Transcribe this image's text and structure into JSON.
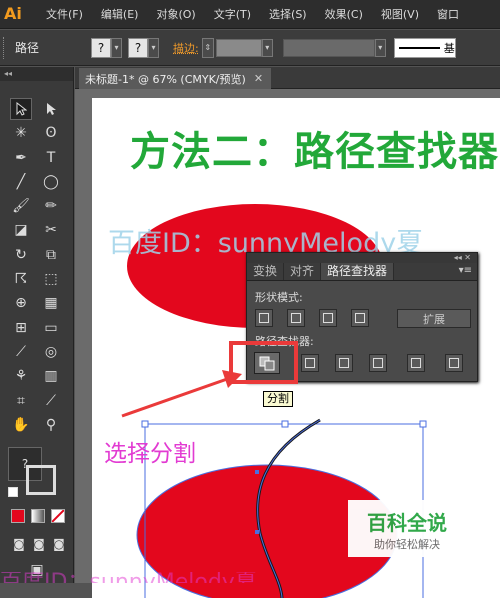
{
  "app": {
    "logo": "Ai"
  },
  "menubar": {
    "items": [
      "文件(F)",
      "编辑(E)",
      "对象(O)",
      "文字(T)",
      "选择(S)",
      "效果(C)",
      "视图(V)",
      "窗口"
    ]
  },
  "control_bar": {
    "label": "路径",
    "stroke_label": "描边:",
    "fill_box": "?",
    "stroke_box": "?",
    "basic_label": "基"
  },
  "document_tab": {
    "title": "未标题-1* @ 67% (CMYK/预览)",
    "close": "✕"
  },
  "artboard": {
    "title": "方法二：路径查找器",
    "watermark": "百度ID：sunnyMelody夏",
    "caption": "选择分割",
    "bottom_partial": "百度ID：sunnyMelody夏"
  },
  "pathfinder_panel": {
    "collapse": "◂◂  ✕",
    "tabs": [
      "变换",
      "对齐",
      "路径查找器"
    ],
    "active_tab": "路径查找器",
    "menu": "▾≡",
    "shape_modes_label": "形状模式:",
    "pathfinders_label": "路径查找器:",
    "expand_label": "扩展",
    "tooltip": "分割"
  },
  "badge": {
    "name": "百科全说",
    "slogan": "助你轻松解决"
  },
  "toolbar": {
    "header": "◂◂",
    "help": "?"
  },
  "colors": {
    "accent": "#ea3a3a",
    "title_green": "#22a839",
    "shape_red": "#e3071d",
    "caption_pink": "#e23bd2"
  }
}
